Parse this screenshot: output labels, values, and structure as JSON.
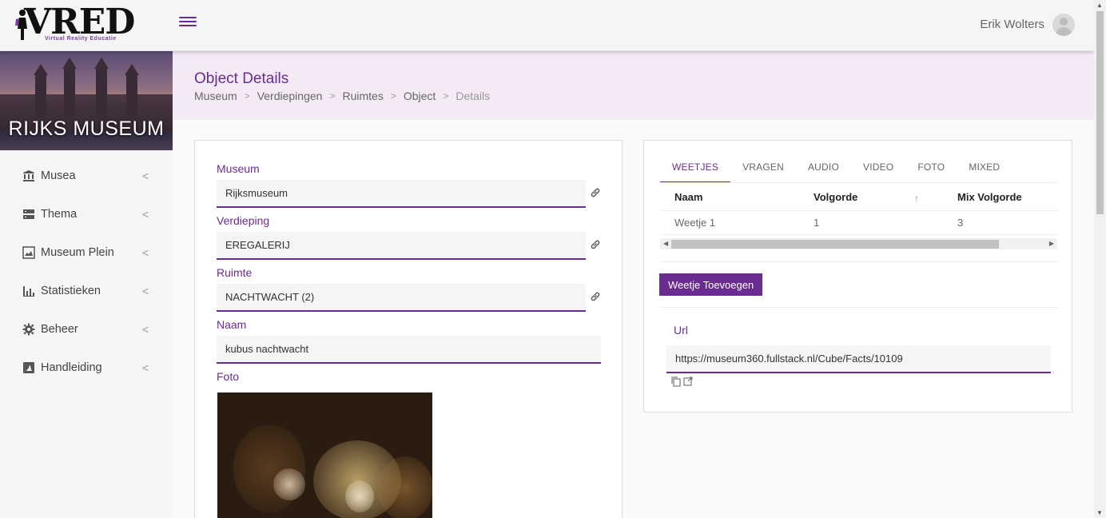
{
  "app": {
    "logo_text": "VRED",
    "logo_tagline": "Virtual Reality Educatie",
    "user_name": "Erik Wolters"
  },
  "sidebar": {
    "banner_title": "RIJKS MUSEUM",
    "items": [
      {
        "label": "Musea",
        "icon": "museum-icon"
      },
      {
        "label": "Thema",
        "icon": "dashboard-icon"
      },
      {
        "label": "Museum Plein",
        "icon": "landscape-icon"
      },
      {
        "label": "Statistieken",
        "icon": "bar-chart-icon"
      },
      {
        "label": "Beheer",
        "icon": "gear-icon"
      },
      {
        "label": "Handleiding",
        "icon": "manual-icon"
      }
    ]
  },
  "header": {
    "title": "Object Details",
    "breadcrumb": [
      "Museum",
      "Verdiepingen",
      "Ruimtes",
      "Object",
      "Details"
    ]
  },
  "form": {
    "museum": {
      "label": "Museum",
      "value": "Rijksmuseum"
    },
    "verdieping": {
      "label": "Verdieping",
      "value": "EREGALERIJ"
    },
    "ruimte": {
      "label": "Ruimte",
      "value": "NACHTWACHT (2)"
    },
    "naam": {
      "label": "Naam",
      "value": "kubus nachtwacht"
    },
    "foto": {
      "label": "Foto"
    }
  },
  "panel": {
    "tabs": [
      "WEETJES",
      "VRAGEN",
      "AUDIO",
      "VIDEO",
      "FOTO",
      "MIXED"
    ],
    "active_tab": "WEETJES",
    "table": {
      "columns": [
        "Naam",
        "Volgorde",
        "Mix Volgorde"
      ],
      "rows": [
        {
          "naam": "Weetje 1",
          "volgorde": "1",
          "mix_volgorde": "3"
        }
      ]
    },
    "add_button": "Weetje Toevoegen",
    "url_label": "Url",
    "url_value": "https://museum360.fullstack.nl/Cube/Facts/10109"
  },
  "colors": {
    "accent": "#6a2c91",
    "header_bg": "#f3eaf6"
  }
}
